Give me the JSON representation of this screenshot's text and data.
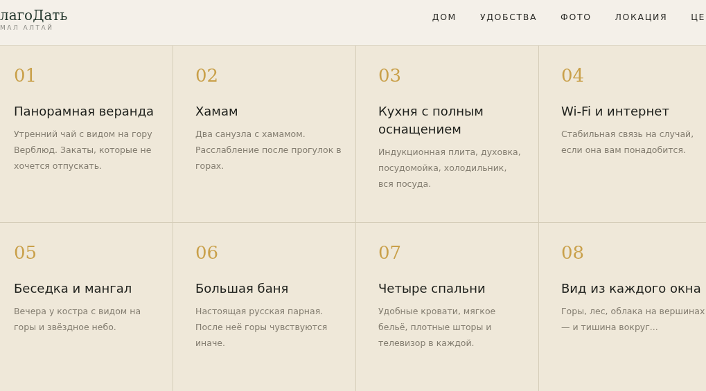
{
  "header": {
    "logo": "лагоДать",
    "tagline": "МАЛ АЛТАЙ",
    "nav": [
      {
        "label": "ДОМ"
      },
      {
        "label": "УДОБСТВА"
      },
      {
        "label": "ФОТО"
      },
      {
        "label": "ЛОКАЦИЯ"
      },
      {
        "label": "ЦЕ"
      }
    ]
  },
  "features": [
    {
      "number": "01",
      "title": "Панорамная веранда",
      "text": "Утренний чай с видом на гору Верблюд. Закаты, которые не хочется отпускать."
    },
    {
      "number": "02",
      "title": "Хамам",
      "text": "Два санузла с хамамом. Расслабление после прогулок в горах."
    },
    {
      "number": "03",
      "title": "Кухня с полным оснащением",
      "text": "Индукционная плита, духовка, посудомойка, холодильник, вся посуда."
    },
    {
      "number": "04",
      "title": "Wi-Fi и интернет",
      "text": "Стабильная связь на случай, если она вам понадобится."
    },
    {
      "number": "05",
      "title": "Беседка и мангал",
      "text": "Вечера у костра с видом на горы и звёздное небо."
    },
    {
      "number": "06",
      "title": "Большая баня",
      "text": "Настоящая русская парная. После неё горы чувствуются иначе."
    },
    {
      "number": "07",
      "title": "Четыре спальни",
      "text": "Удобные кровати, мягкое бельё, плотные шторы и телевизор в каждой."
    },
    {
      "number": "08",
      "title": "Вид из каждого окна",
      "text": "Горы, лес, облака на вершинах — и тишина вокруг..."
    }
  ]
}
